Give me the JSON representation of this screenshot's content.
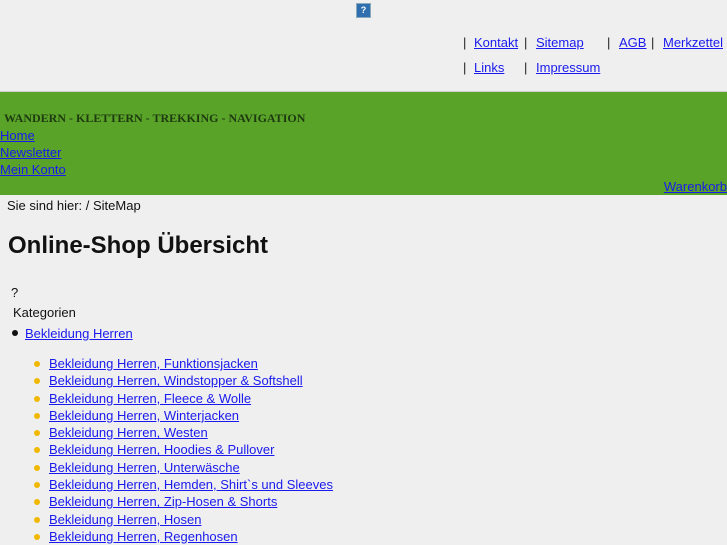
{
  "header": {
    "broken_image_glyph": "?",
    "top_links": [
      "Kontakt",
      "Sitemap",
      "AGB",
      "Merkzettel",
      "Links",
      "Impressum"
    ],
    "separator": "|"
  },
  "banner": {
    "tagline": "WANDERN - KLETTERN - TREKKING - NAVIGATION",
    "nav": [
      "Home",
      "Newsletter",
      "Mein Konto"
    ],
    "cart": "Warenkorb"
  },
  "breadcrumb": "Sie sind hier: / SiteMap",
  "page_title": "Online-Shop Übersicht",
  "question_mark": "?",
  "categories_label": "Kategorien",
  "category": {
    "label": "Bekleidung Herren",
    "subcategories": [
      "Bekleidung Herren, Funktionsjacken",
      "Bekleidung Herren, Windstopper & Softshell",
      "Bekleidung Herren, Fleece & Wolle",
      "Bekleidung Herren, Winterjacken",
      "Bekleidung Herren, Westen",
      "Bekleidung Herren, Hoodies & Pullover",
      "Bekleidung Herren, Unterwäsche",
      "Bekleidung Herren, Hemden, Shirt`s und Sleeves",
      "Bekleidung Herren, Zip-Hosen & Shorts",
      "Bekleidung Herren, Hosen",
      "Bekleidung Herren, Regenhosen"
    ]
  }
}
